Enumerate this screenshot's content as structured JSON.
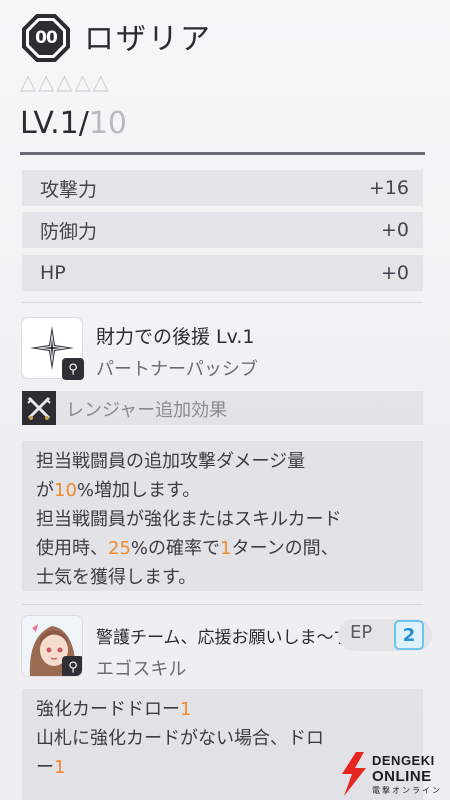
{
  "header": {
    "badge_text": "00",
    "name": "ロザリア",
    "stars": "△△△△△",
    "level_current": "LV.1/",
    "level_max": "10"
  },
  "stats": [
    {
      "label": "攻撃力",
      "value": "+16"
    },
    {
      "label": "防御力",
      "value": "+0"
    },
    {
      "label": "HP",
      "value": "+0"
    }
  ],
  "passive_skill": {
    "icon": "sparkle-icon",
    "title": "財力での後援 Lv.1",
    "subtitle": "パートナーパッシブ",
    "ranger_icon": "crossed-swords-icon",
    "ranger_label": "レンジャー追加効果",
    "desc": {
      "l1": "担当戦闘員の追加攻撃ダメージ量",
      "l2a": "が",
      "l2b": "10",
      "l2c": "%増加します。",
      "l3": "担当戦闘員が強化またはスキルカード",
      "l4a": "使用時、",
      "l4b": "25",
      "l4c": "%の確率で",
      "l4d": "1",
      "l4e": "ターンの間、",
      "l5": "士気を獲得します。"
    }
  },
  "ego_skill": {
    "icon": "character-portrait",
    "title": "警護チーム、応援お願いしま〜す！",
    "subtitle": "エゴスキル",
    "ep_label": "EP",
    "ep_value": "2",
    "desc": {
      "l1a": "強化カードドロー",
      "l1b": "1",
      "l2": "山札に強化カードがない場合、ドロ",
      "l3a": "ー",
      "l3b": "1"
    }
  },
  "watermark": {
    "line1": "DENGEKI",
    "line2": "ONLINE",
    "line3": "電撃オンライン"
  },
  "colors": {
    "highlight": "#f08a2a",
    "ep_accent": "#6cc3ef"
  }
}
